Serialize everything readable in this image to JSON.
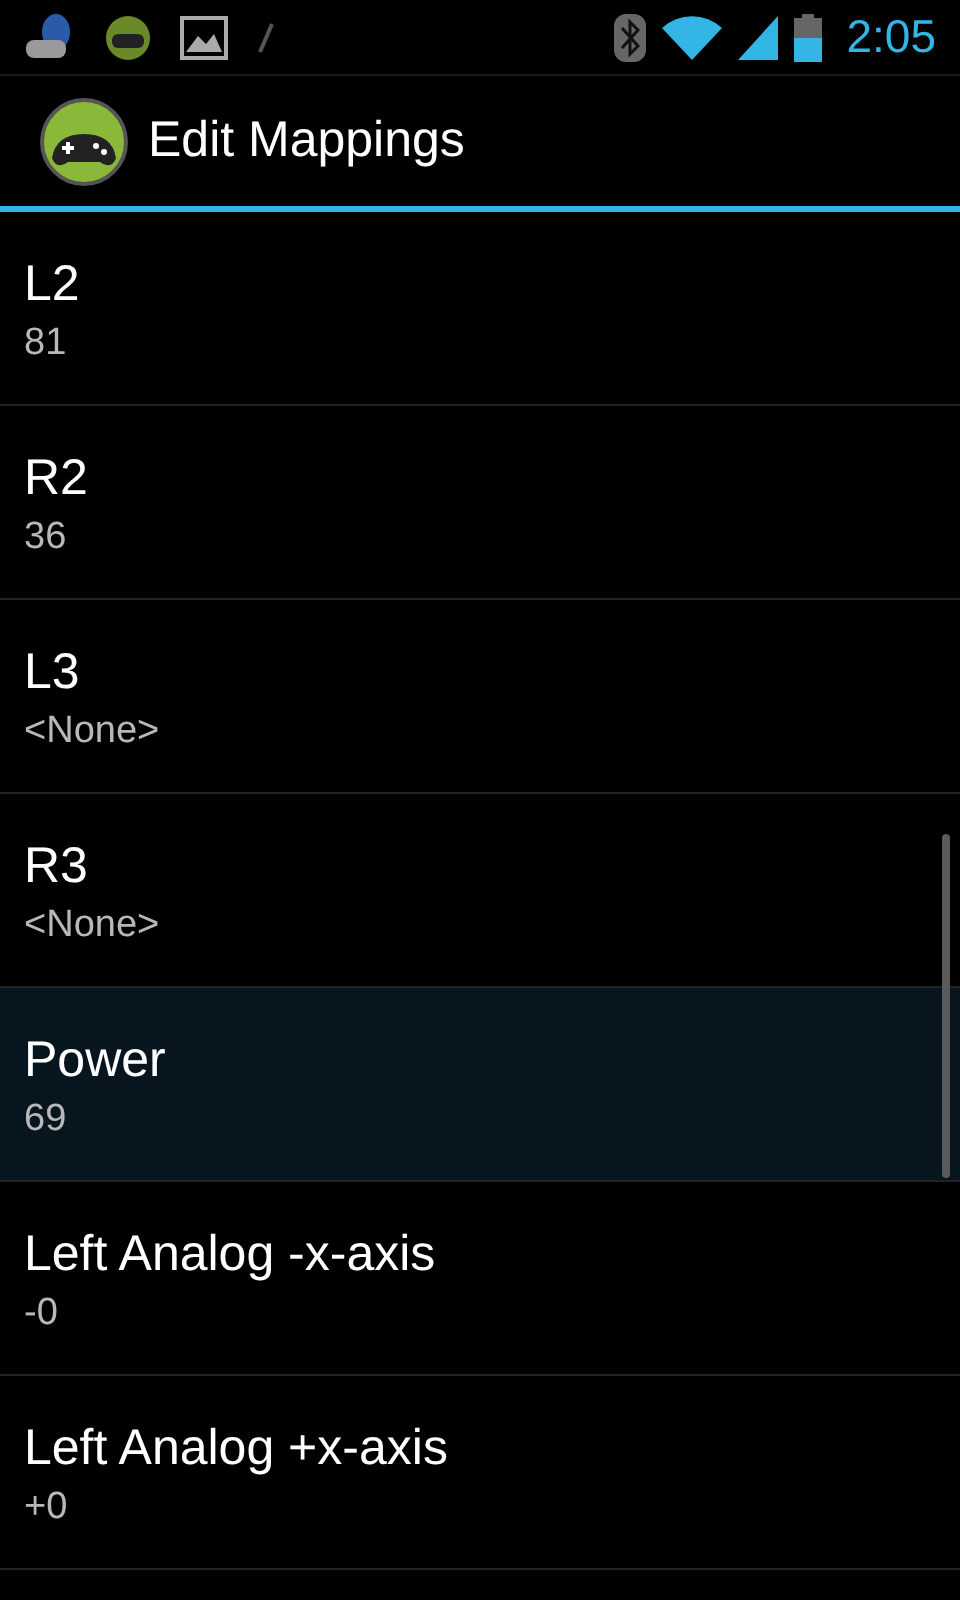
{
  "status_bar": {
    "time": "2:05"
  },
  "action_bar": {
    "title": "Edit Mappings"
  },
  "mappings": [
    {
      "name": "L2",
      "value": "81",
      "selected": false
    },
    {
      "name": "R2",
      "value": "36",
      "selected": false
    },
    {
      "name": "L3",
      "value": "<None>",
      "selected": false
    },
    {
      "name": "R3",
      "value": "<None>",
      "selected": false
    },
    {
      "name": "Power",
      "value": "69",
      "selected": true
    },
    {
      "name": "Left Analog -x-axis",
      "value": "-0",
      "selected": false
    },
    {
      "name": "Left Analog +x-axis",
      "value": "+0",
      "selected": false
    }
  ]
}
